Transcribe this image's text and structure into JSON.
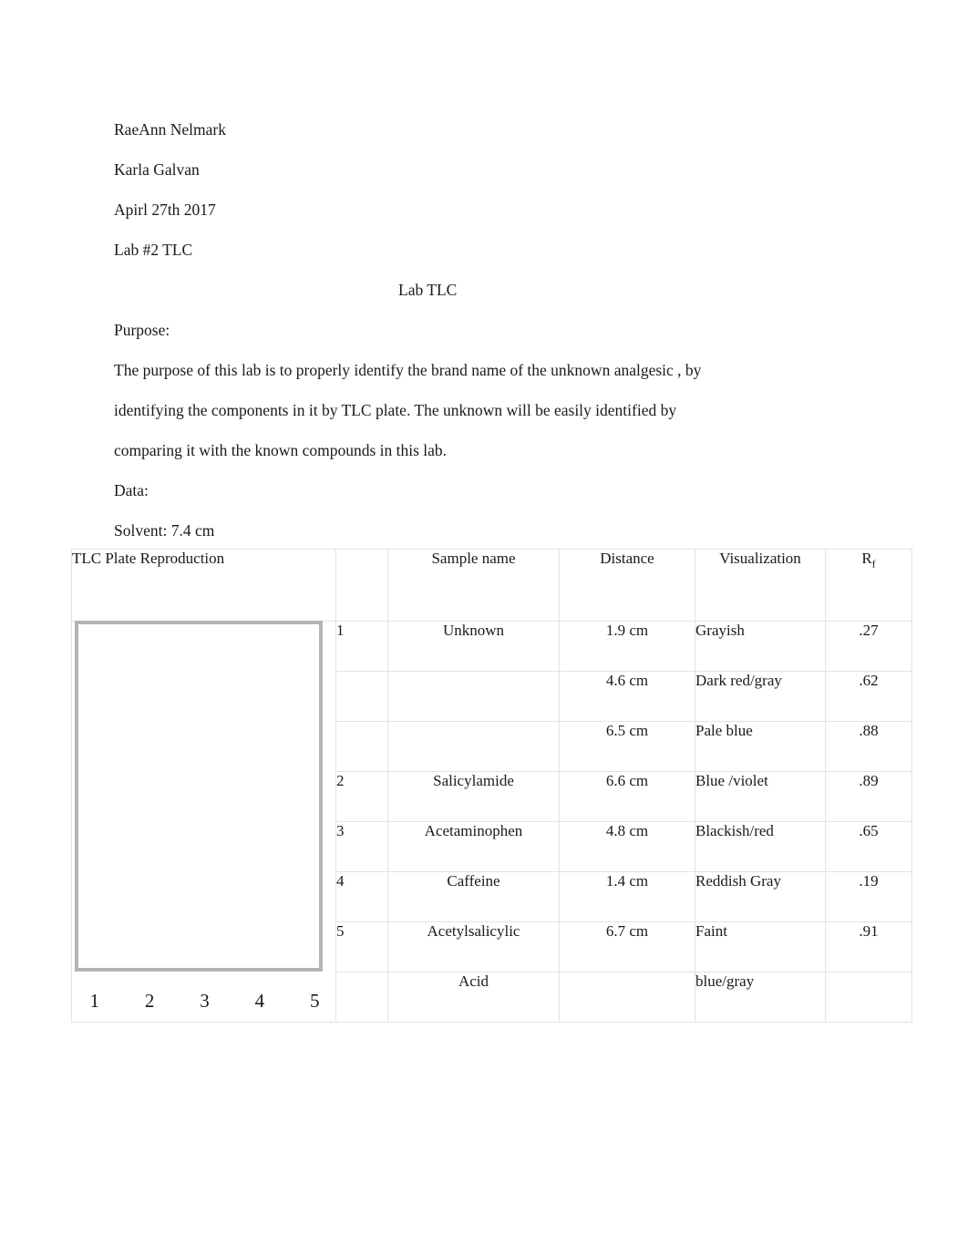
{
  "header": {
    "student_name": "RaeAnn Nelmark",
    "instructor_name": "Karla Galvan",
    "date": "Apirl 27th 2017",
    "lab_number": "Lab #2 TLC",
    "title": "Lab TLC"
  },
  "sections": {
    "purpose_label": "Purpose:",
    "purpose_text": "The purpose of this lab is to properly identify the brand name of the unknown analgesic , by identifying the components in it by TLC plate. The unknown will be easily identified by comparing it with the known compounds in this lab.",
    "purpose_line_1": "The purpose of this lab is to properly identify the brand name of the unknown analgesic , by",
    "purpose_line_2": "identifying the components in it by TLC plate. The unknown will be easily identified by",
    "purpose_line_3": "comparing it with the known compounds in this lab.",
    "data_label": "Data:",
    "solvent_label": "Solvent: 7.4 cm"
  },
  "table": {
    "plate_header": "TLC Plate Reproduction",
    "columns": {
      "number": "",
      "sample_name": "Sample name",
      "distance": "Distance",
      "visualization": "Visualization",
      "rf_main": "R",
      "rf_sub": "f"
    },
    "plate": {
      "lane_labels": [
        "1",
        "2",
        "3",
        "4",
        "5"
      ],
      "border_color": "#b4b4b4"
    },
    "rows": [
      {
        "number": "1",
        "sample_name": "Unknown",
        "sample_name_2": "",
        "distance": "1.9 cm",
        "visualization": "Grayish",
        "rf": ".27"
      },
      {
        "number": "",
        "sample_name": "",
        "sample_name_2": "",
        "distance": "4.6 cm",
        "visualization": "Dark red/gray",
        "rf": ".62"
      },
      {
        "number": "",
        "sample_name": "",
        "sample_name_2": "",
        "distance": "6.5 cm",
        "visualization": "Pale blue",
        "rf": ".88"
      },
      {
        "number": "2",
        "sample_name": "Salicylamide",
        "sample_name_2": "",
        "distance": "6.6 cm",
        "visualization": "Blue /violet",
        "rf": ".89"
      },
      {
        "number": "3",
        "sample_name": "Acetaminophen",
        "sample_name_2": "",
        "distance": "4.8 cm",
        "visualization": "Blackish/red",
        "rf": ".65"
      },
      {
        "number": "4",
        "sample_name": "Caffeine",
        "sample_name_2": "",
        "distance": "1.4 cm",
        "visualization": "Reddish Gray",
        "rf": ".19"
      },
      {
        "number": "5",
        "sample_name": "Acetylsalicylic",
        "sample_name_2": "",
        "distance": "6.7 cm",
        "visualization": "Faint",
        "rf": ".91"
      },
      {
        "number": "",
        "sample_name": "Acid",
        "sample_name_2": "",
        "distance": "",
        "visualization": "blue/gray",
        "rf": ""
      }
    ]
  }
}
